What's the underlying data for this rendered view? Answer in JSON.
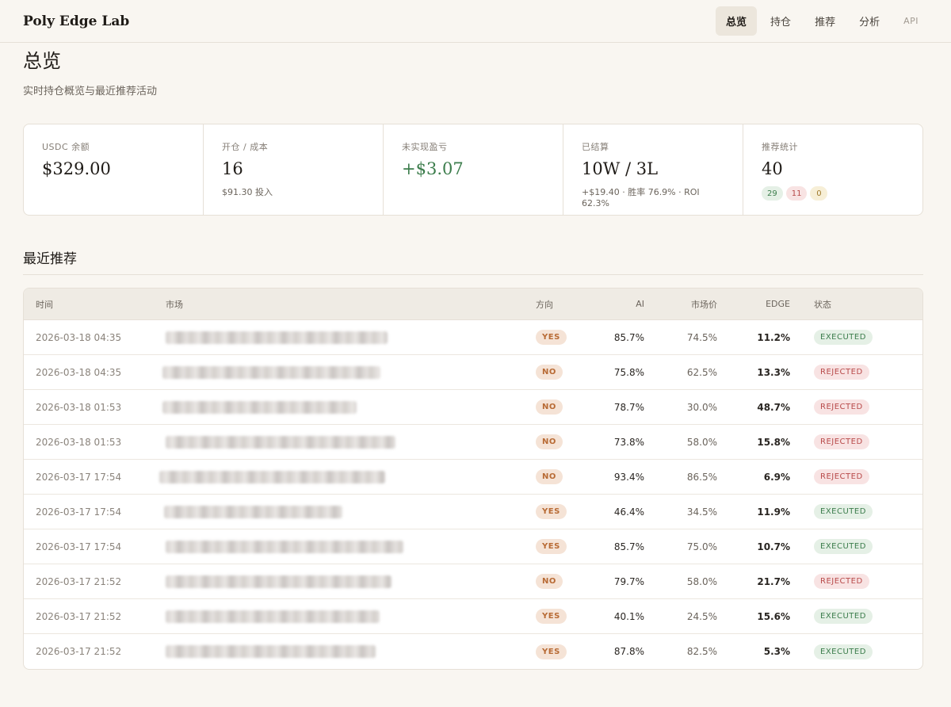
{
  "brand": "Poly Edge Lab",
  "nav": {
    "items": [
      {
        "label": "总览",
        "active": true
      },
      {
        "label": "持仓",
        "active": false
      },
      {
        "label": "推荐",
        "active": false
      },
      {
        "label": "分析",
        "active": false
      },
      {
        "label": "API",
        "active": false
      }
    ]
  },
  "page": {
    "title": "总览",
    "subtitle": "实时持仓概览与最近推荐活动"
  },
  "stats": [
    {
      "label": "USDC 余额",
      "value": "$329.00",
      "sub": ""
    },
    {
      "label": "开仓 / 成本",
      "value": "16",
      "sub": "$91.30 投入"
    },
    {
      "label": "未实现盈亏",
      "value": "+$3.07",
      "sub": "",
      "color": "#3c7d4c"
    },
    {
      "label": "已结算",
      "value": "10W / 3L",
      "sub": "+$19.40 · 胜率 76.9% · ROI 62.3%"
    },
    {
      "label": "推荐统计",
      "value": "40",
      "sub": "",
      "pills": [
        "29",
        "11",
        "0"
      ]
    }
  ],
  "recent": {
    "title": "最近推荐",
    "columns": {
      "time": "时间",
      "market": "市场",
      "direction": "方向",
      "ai": "AI",
      "market_price": "市场价",
      "edge": "EDGE",
      "status": "状态"
    },
    "rows": [
      {
        "time": "2026-03-18 04:35",
        "direction": "YES",
        "ai": "85.7%",
        "market_price": "74.5%",
        "edge": "11.2%",
        "status": "EXECUTED"
      },
      {
        "time": "2026-03-18 04:35",
        "direction": "NO",
        "ai": "75.8%",
        "market_price": "62.5%",
        "edge": "13.3%",
        "status": "REJECTED"
      },
      {
        "time": "2026-03-18 01:53",
        "direction": "NO",
        "ai": "78.7%",
        "market_price": "30.0%",
        "edge": "48.7%",
        "status": "REJECTED"
      },
      {
        "time": "2026-03-18 01:53",
        "direction": "NO",
        "ai": "73.8%",
        "market_price": "58.0%",
        "edge": "15.8%",
        "status": "REJECTED"
      },
      {
        "time": "2026-03-17 17:54",
        "direction": "NO",
        "ai": "93.4%",
        "market_price": "86.5%",
        "edge": "6.9%",
        "status": "REJECTED"
      },
      {
        "time": "2026-03-17 17:54",
        "direction": "YES",
        "ai": "46.4%",
        "market_price": "34.5%",
        "edge": "11.9%",
        "status": "EXECUTED"
      },
      {
        "time": "2026-03-17 17:54",
        "direction": "YES",
        "ai": "85.7%",
        "market_price": "75.0%",
        "edge": "10.7%",
        "status": "EXECUTED"
      },
      {
        "time": "2026-03-17 21:52",
        "direction": "NO",
        "ai": "79.7%",
        "market_price": "58.0%",
        "edge": "21.7%",
        "status": "REJECTED"
      },
      {
        "time": "2026-03-17 21:52",
        "direction": "YES",
        "ai": "40.1%",
        "market_price": "24.5%",
        "edge": "15.6%",
        "status": "EXECUTED"
      },
      {
        "time": "2026-03-17 21:52",
        "direction": "YES",
        "ai": "87.8%",
        "market_price": "82.5%",
        "edge": "5.3%",
        "status": "EXECUTED"
      }
    ]
  }
}
